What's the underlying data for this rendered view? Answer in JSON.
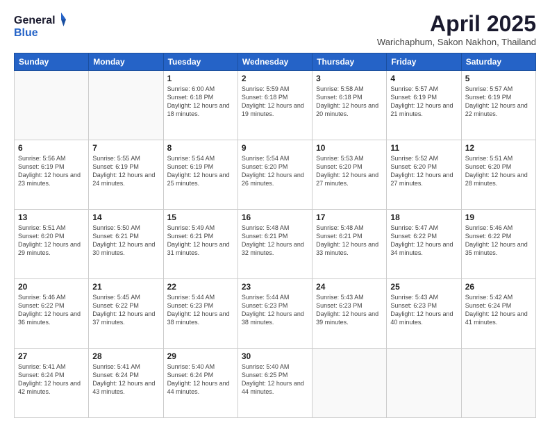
{
  "header": {
    "logo_general": "General",
    "logo_blue": "Blue",
    "month_title": "April 2025",
    "subtitle": "Warichaphum, Sakon Nakhon, Thailand"
  },
  "days_of_week": [
    "Sunday",
    "Monday",
    "Tuesday",
    "Wednesday",
    "Thursday",
    "Friday",
    "Saturday"
  ],
  "weeks": [
    [
      {
        "day": "",
        "info": ""
      },
      {
        "day": "",
        "info": ""
      },
      {
        "day": "1",
        "info": "Sunrise: 6:00 AM\nSunset: 6:18 PM\nDaylight: 12 hours and 18 minutes."
      },
      {
        "day": "2",
        "info": "Sunrise: 5:59 AM\nSunset: 6:18 PM\nDaylight: 12 hours and 19 minutes."
      },
      {
        "day": "3",
        "info": "Sunrise: 5:58 AM\nSunset: 6:18 PM\nDaylight: 12 hours and 20 minutes."
      },
      {
        "day": "4",
        "info": "Sunrise: 5:57 AM\nSunset: 6:19 PM\nDaylight: 12 hours and 21 minutes."
      },
      {
        "day": "5",
        "info": "Sunrise: 5:57 AM\nSunset: 6:19 PM\nDaylight: 12 hours and 22 minutes."
      }
    ],
    [
      {
        "day": "6",
        "info": "Sunrise: 5:56 AM\nSunset: 6:19 PM\nDaylight: 12 hours and 23 minutes."
      },
      {
        "day": "7",
        "info": "Sunrise: 5:55 AM\nSunset: 6:19 PM\nDaylight: 12 hours and 24 minutes."
      },
      {
        "day": "8",
        "info": "Sunrise: 5:54 AM\nSunset: 6:19 PM\nDaylight: 12 hours and 25 minutes."
      },
      {
        "day": "9",
        "info": "Sunrise: 5:54 AM\nSunset: 6:20 PM\nDaylight: 12 hours and 26 minutes."
      },
      {
        "day": "10",
        "info": "Sunrise: 5:53 AM\nSunset: 6:20 PM\nDaylight: 12 hours and 27 minutes."
      },
      {
        "day": "11",
        "info": "Sunrise: 5:52 AM\nSunset: 6:20 PM\nDaylight: 12 hours and 27 minutes."
      },
      {
        "day": "12",
        "info": "Sunrise: 5:51 AM\nSunset: 6:20 PM\nDaylight: 12 hours and 28 minutes."
      }
    ],
    [
      {
        "day": "13",
        "info": "Sunrise: 5:51 AM\nSunset: 6:20 PM\nDaylight: 12 hours and 29 minutes."
      },
      {
        "day": "14",
        "info": "Sunrise: 5:50 AM\nSunset: 6:21 PM\nDaylight: 12 hours and 30 minutes."
      },
      {
        "day": "15",
        "info": "Sunrise: 5:49 AM\nSunset: 6:21 PM\nDaylight: 12 hours and 31 minutes."
      },
      {
        "day": "16",
        "info": "Sunrise: 5:48 AM\nSunset: 6:21 PM\nDaylight: 12 hours and 32 minutes."
      },
      {
        "day": "17",
        "info": "Sunrise: 5:48 AM\nSunset: 6:21 PM\nDaylight: 12 hours and 33 minutes."
      },
      {
        "day": "18",
        "info": "Sunrise: 5:47 AM\nSunset: 6:22 PM\nDaylight: 12 hours and 34 minutes."
      },
      {
        "day": "19",
        "info": "Sunrise: 5:46 AM\nSunset: 6:22 PM\nDaylight: 12 hours and 35 minutes."
      }
    ],
    [
      {
        "day": "20",
        "info": "Sunrise: 5:46 AM\nSunset: 6:22 PM\nDaylight: 12 hours and 36 minutes."
      },
      {
        "day": "21",
        "info": "Sunrise: 5:45 AM\nSunset: 6:22 PM\nDaylight: 12 hours and 37 minutes."
      },
      {
        "day": "22",
        "info": "Sunrise: 5:44 AM\nSunset: 6:23 PM\nDaylight: 12 hours and 38 minutes."
      },
      {
        "day": "23",
        "info": "Sunrise: 5:44 AM\nSunset: 6:23 PM\nDaylight: 12 hours and 38 minutes."
      },
      {
        "day": "24",
        "info": "Sunrise: 5:43 AM\nSunset: 6:23 PM\nDaylight: 12 hours and 39 minutes."
      },
      {
        "day": "25",
        "info": "Sunrise: 5:43 AM\nSunset: 6:23 PM\nDaylight: 12 hours and 40 minutes."
      },
      {
        "day": "26",
        "info": "Sunrise: 5:42 AM\nSunset: 6:24 PM\nDaylight: 12 hours and 41 minutes."
      }
    ],
    [
      {
        "day": "27",
        "info": "Sunrise: 5:41 AM\nSunset: 6:24 PM\nDaylight: 12 hours and 42 minutes."
      },
      {
        "day": "28",
        "info": "Sunrise: 5:41 AM\nSunset: 6:24 PM\nDaylight: 12 hours and 43 minutes."
      },
      {
        "day": "29",
        "info": "Sunrise: 5:40 AM\nSunset: 6:24 PM\nDaylight: 12 hours and 44 minutes."
      },
      {
        "day": "30",
        "info": "Sunrise: 5:40 AM\nSunset: 6:25 PM\nDaylight: 12 hours and 44 minutes."
      },
      {
        "day": "",
        "info": ""
      },
      {
        "day": "",
        "info": ""
      },
      {
        "day": "",
        "info": ""
      }
    ]
  ]
}
